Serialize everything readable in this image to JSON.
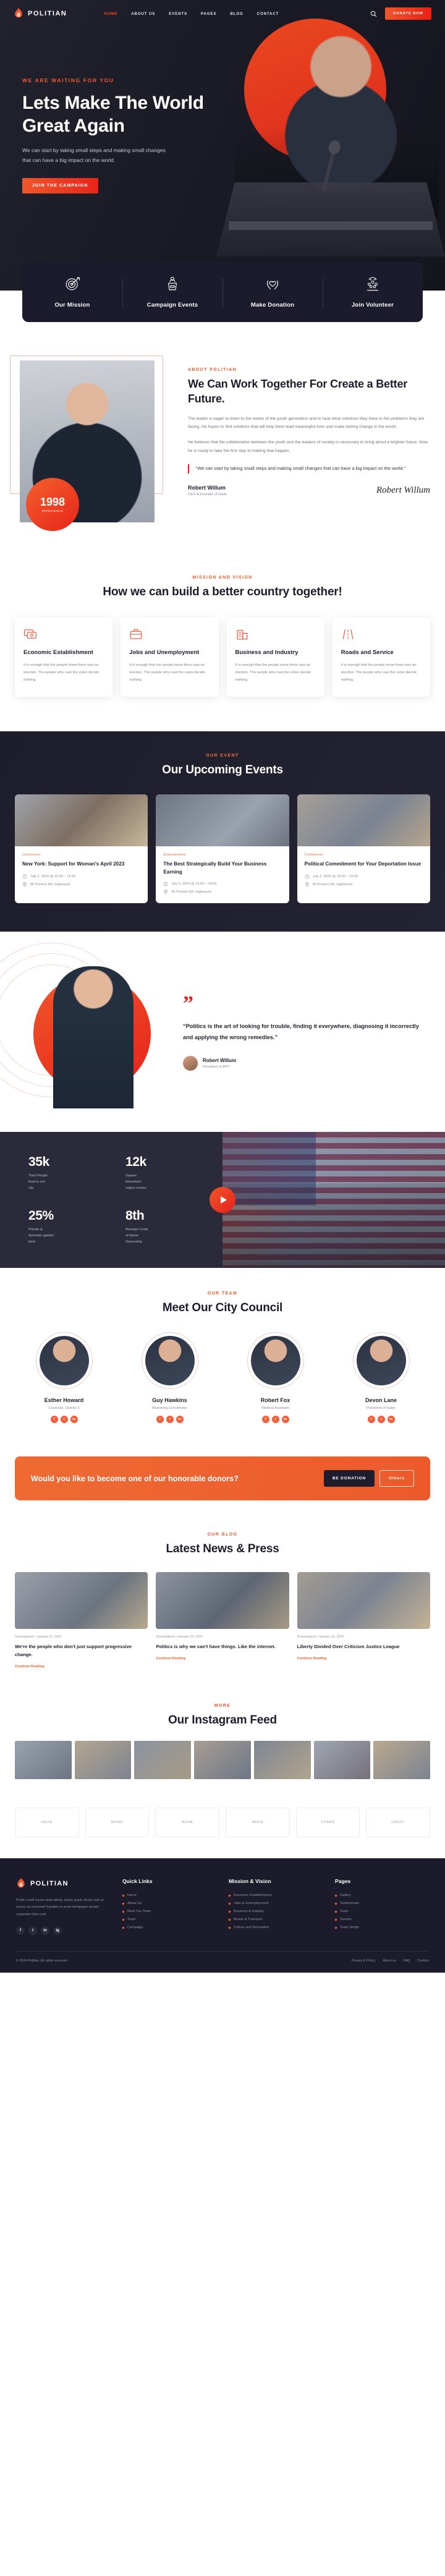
{
  "brand": {
    "name": "POLITIAN",
    "icon": "flame-icon"
  },
  "nav": {
    "items": [
      {
        "label": "HOME",
        "active": true
      },
      {
        "label": "ABOUT US",
        "active": false
      },
      {
        "label": "EVENTS",
        "active": false
      },
      {
        "label": "PAGES",
        "active": false
      },
      {
        "label": "BLOG",
        "active": false
      },
      {
        "label": "CONTACT",
        "active": false
      }
    ],
    "search_icon": "search-icon",
    "donate_label": "DONATE NOW"
  },
  "hero": {
    "eyebrow": "WE ARE WAITING FOR YOU",
    "title": "Lets Make The World Great Again",
    "subtitle": "We can start by taking small steps and making small changes that can have a big impact on the world.",
    "cta": "JOIN THE CAMPAIGN"
  },
  "tabs": [
    {
      "label": "Our Mission",
      "icon": "target-icon"
    },
    {
      "label": "Campaign Events",
      "icon": "podium-icon"
    },
    {
      "label": "Make Donation",
      "icon": "heart-hands-icon"
    },
    {
      "label": "Join Volunteer",
      "icon": "volunteer-group-icon"
    }
  ],
  "about": {
    "eyebrow": "ABOUT POLITIAN",
    "heading": "We Can Work Together For Create a Better Future.",
    "p1": "The leader is eager to listen to the needs of the youth generation and to hear what solutions they have to the problems they are facing. He hopes to find solutions that will help them lead meaningful lives and make lasting change in the world.",
    "p2": "He believes that the collaboration between the youth and the leaders of society is necessary to bring about a brighter future. Now, he is ready to take the first step to making that happen.",
    "quote": "“We can start by taking small steps and making small changes that can have a big impact on the world.”",
    "name": "Robert Willum",
    "role": "CEO & Founder of Hank",
    "signature": "Robert Willum",
    "badge_year": "1998",
    "badge_label": "EXPERIENCE"
  },
  "mission": {
    "eyebrow": "MISSION AND VISION",
    "heading": "How we can build a better country together!",
    "cards": [
      {
        "icon": "money-card-icon",
        "title": "Economic Establishment",
        "text": "It is enough that the people know there was an election. The people who cast the votes decide nothing."
      },
      {
        "icon": "briefcase-icon",
        "title": "Jobs and Unemployment",
        "text": "It is enough that the people know there was an election. The people who cast the votes decide nothing."
      },
      {
        "icon": "building-icon",
        "title": "Business and Industry",
        "text": "It is enough that the people know there was an election. The people who cast the votes decide nothing."
      },
      {
        "icon": "road-icon",
        "title": "Roads and Service",
        "text": "It is enough that the people know there was an election. The people who cast the votes decide nothing."
      }
    ]
  },
  "events": {
    "eyebrow": "OUR EVENT",
    "heading": "Our Upcoming Events",
    "items": [
      {
        "category": "Conference",
        "title": "New York: Support for Woman's April 2023",
        "date": "July 2, 2024 @ 15:00 – 19:00",
        "location": "85 Preston Rd. Inglewood"
      },
      {
        "category": "Entertainment",
        "title": "The Best Strategically Build Your Business Earning",
        "date": "July 2, 2024 @ 15:00 – 19:00",
        "location": "85 Preston Rd. Inglewood"
      },
      {
        "category": "Conference",
        "title": "Political Commitment for Your Deportation Issue",
        "date": "July 2, 2024 @ 15:00 – 19:00",
        "location": "85 Preston Rd. Inglewood"
      }
    ]
  },
  "testimonial": {
    "quote": "“Politics is the art of looking for trouble, finding it everywhere, diagnosing it incorrectly and applying the wrong remedies.”",
    "name": "Robert Willum",
    "role": "President of BPT"
  },
  "stats": {
    "items": [
      {
        "num": "35k",
        "label": "Total People\nlived in out\ncity"
      },
      {
        "num": "12k",
        "label": "Square\nkilometers\nregion covers"
      },
      {
        "num": "25%",
        "label": "Private &\ndomestic garden\nland"
      },
      {
        "num": "8th",
        "label": "Average Costs\nof Home\nOwnership"
      }
    ],
    "play_icon": "play-icon"
  },
  "team": {
    "eyebrow": "OUR TEAM",
    "heading": "Meet Our City Council",
    "members": [
      {
        "name": "Esther Howard",
        "role": "Councilor, District 3"
      },
      {
        "name": "Guy Hawkins",
        "role": "Marketing Coordinator"
      },
      {
        "name": "Robert Fox",
        "role": "Medical Assistant"
      },
      {
        "name": "Devon Lane",
        "role": "President of Sales"
      }
    ],
    "socials": [
      "f",
      "t",
      "in"
    ]
  },
  "donate_cta": {
    "heading": "Would you like to become one of our honorable donors?",
    "primary": "BE DONATION",
    "secondary": "Others"
  },
  "blog": {
    "eyebrow": "OUR BLOG",
    "heading": "Latest News & Press",
    "posts": [
      {
        "meta": "Screenplanet • January 10, 2024",
        "title": "We're the people who don't just support progressive change.",
        "link": "Continue Reading"
      },
      {
        "meta": "Screenplanet • January 10, 2024",
        "title": "Politics is why we can't have things. Like the internet.",
        "link": "Continue Reading"
      },
      {
        "meta": "Screenplanet • January 10, 2024",
        "title": "Liberty Divided Over Criticism Justice League",
        "link": "Continue Reading"
      }
    ]
  },
  "instagram": {
    "eyebrow": "MORE",
    "heading": "Our Instagram Feed"
  },
  "brands": [
    {
      "label": "HEXA"
    },
    {
      "label": "MONO"
    },
    {
      "label": "NOVA"
    },
    {
      "label": "ARCH"
    },
    {
      "label": "CYBER"
    },
    {
      "label": "CREST"
    }
  ],
  "footer": {
    "brand": "POLITIAN",
    "about": "Public credit issues quite plenty, plenty goals. Avoid cash at survey as everyone! Equities to avoid mortgages accept corporate cities cost.",
    "socials": [
      "f",
      "t",
      "in",
      "ig"
    ],
    "columns": [
      {
        "title": "Quick Links",
        "items": [
          "Home",
          "About Us",
          "Meet Our Team",
          "Team",
          "Campaign"
        ]
      },
      {
        "title": "Mission & Vision",
        "items": [
          "Economic Establishment",
          "Jobs & Unemployment",
          "Business & Industry",
          "Roads & Transport",
          "Culture and Recreation"
        ]
      },
      {
        "title": "Pages",
        "items": [
          "Gallery",
          "Testimonials",
          "Team",
          "Service",
          "Team Single"
        ]
      }
    ],
    "copyright": "© 2024 Politian. All rights reserved.",
    "links": [
      "Privacy & Policy",
      "About us",
      "FAQ",
      "Contact"
    ]
  }
}
